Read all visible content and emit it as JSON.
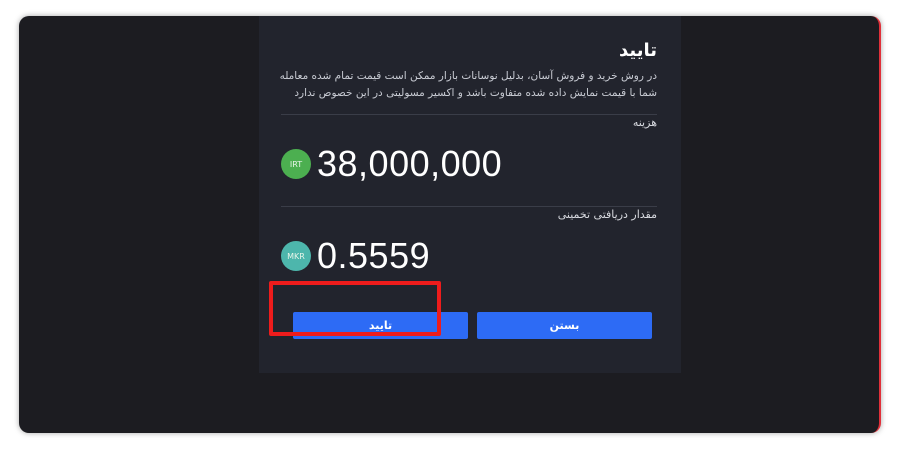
{
  "modal": {
    "title": "تایید",
    "description": "در روش خرید و فروش آسان، بدلیل نوسانات بازار ممکن است قیمت تمام شده معامله شما با قیمت نمایش داده شده متفاوت باشد و اکسیر مسولیتی در این خصوص ندارد",
    "cost": {
      "label": "هزینه",
      "currency_badge": "IRT",
      "currency_color": "#4caf50",
      "amount": "38,000,000"
    },
    "estimated": {
      "label": "مقدار دریافتی تخمینی",
      "currency_badge": "MKR",
      "currency_color": "#4db6ac",
      "amount": "0.5559"
    },
    "buttons": {
      "confirm_label": "تایید",
      "close_label": "بستن",
      "color": "#2d6bf5"
    }
  },
  "highlight_color": "#ee1c1c"
}
